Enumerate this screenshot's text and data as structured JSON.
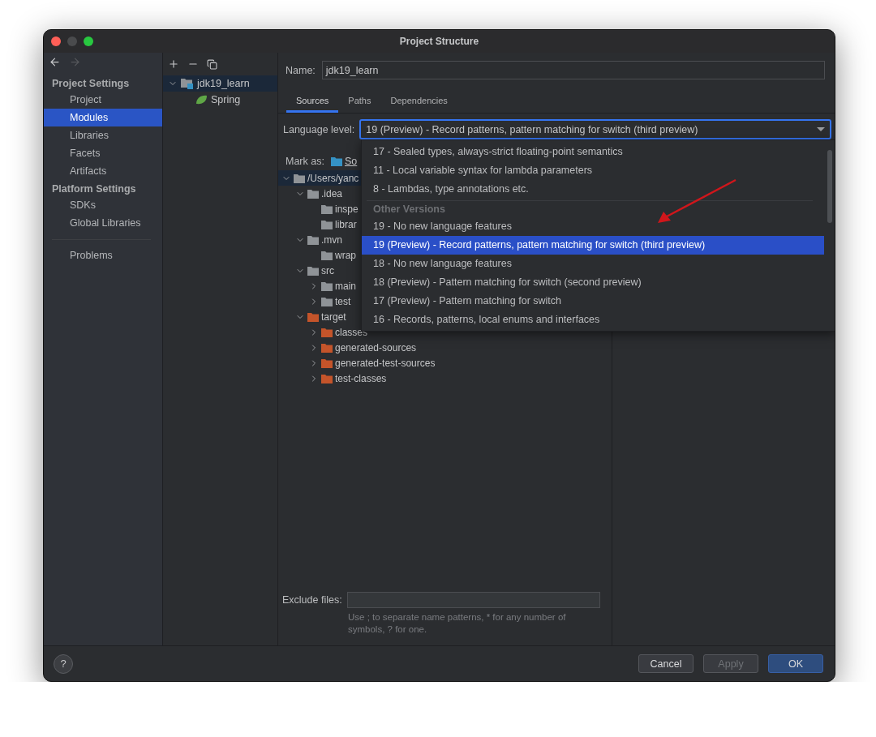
{
  "window": {
    "title": "Project Structure"
  },
  "sidebar": {
    "sections": [
      {
        "title": "Project Settings",
        "items": [
          {
            "label": "Project",
            "selected": false
          },
          {
            "label": "Modules",
            "selected": true
          },
          {
            "label": "Libraries",
            "selected": false
          },
          {
            "label": "Facets",
            "selected": false
          },
          {
            "label": "Artifacts",
            "selected": false
          }
        ]
      },
      {
        "title": "Platform Settings",
        "items": [
          {
            "label": "SDKs",
            "selected": false
          },
          {
            "label": "Global Libraries",
            "selected": false
          }
        ]
      }
    ],
    "extra_items": [
      {
        "label": "Problems",
        "selected": false
      }
    ]
  },
  "modules": [
    {
      "label": "jdk19_learn",
      "kind": "module",
      "expanded": true,
      "selected": true,
      "children": [
        {
          "label": "Spring",
          "kind": "facet",
          "selected": false
        }
      ]
    }
  ],
  "name_field": {
    "label": "Name:",
    "value": "jdk19_learn"
  },
  "tabs": [
    {
      "label": "Sources",
      "selected": true
    },
    {
      "label": "Paths",
      "selected": false
    },
    {
      "label": "Dependencies",
      "selected": false
    }
  ],
  "language_level": {
    "label": "Language level:",
    "value": "19 (Preview) - Record patterns, pattern matching for switch (third preview)",
    "expanded": true,
    "options": [
      {
        "label": "17 - Sealed types, always-strict floating-point semantics",
        "kind": "option",
        "selected": false
      },
      {
        "label": "11 - Local variable syntax for lambda parameters",
        "kind": "option",
        "selected": false
      },
      {
        "label": "8 - Lambdas, type annotations etc.",
        "kind": "option",
        "selected": false
      },
      {
        "label": "Other Versions",
        "kind": "header"
      },
      {
        "label": "19 - No new language features",
        "kind": "option",
        "selected": false
      },
      {
        "label": "19 (Preview) - Record patterns, pattern matching for switch (third preview)",
        "kind": "option",
        "selected": true
      },
      {
        "label": "18 - No new language features",
        "kind": "option",
        "selected": false
      },
      {
        "label": "18 (Preview) - Pattern matching for switch (second preview)",
        "kind": "option",
        "selected": false
      },
      {
        "label": "17 (Preview) - Pattern matching for switch",
        "kind": "option",
        "selected": false
      },
      {
        "label": "16 - Records, patterns, local enums and interfaces",
        "kind": "option",
        "selected": false
      }
    ]
  },
  "mark_as": {
    "label": "Mark as:",
    "items": [
      {
        "label": "So"
      }
    ]
  },
  "content_tree": [
    {
      "label": "/Users/yanc",
      "kind": "folder",
      "expanded": true,
      "selected": true,
      "children": [
        {
          "label": ".idea",
          "kind": "folder",
          "expanded": true,
          "selected": false,
          "children": [
            {
              "label": "inspe",
              "kind": "folder",
              "selected": false
            },
            {
              "label": "librar",
              "kind": "folder",
              "selected": false
            }
          ]
        },
        {
          "label": ".mvn",
          "kind": "folder",
          "expanded": true,
          "selected": false,
          "children": [
            {
              "label": "wrap",
              "kind": "folder",
              "selected": false
            }
          ]
        },
        {
          "label": "src",
          "kind": "folder",
          "expanded": true,
          "selected": false,
          "children": [
            {
              "label": "main",
              "kind": "folder",
              "expanded": false,
              "selected": false
            },
            {
              "label": "test",
              "kind": "folder",
              "expanded": false,
              "selected": false
            }
          ]
        },
        {
          "label": "target",
          "kind": "excluded",
          "expanded": true,
          "selected": false,
          "children": [
            {
              "label": "classes",
              "kind": "excluded",
              "expanded": false,
              "selected": false
            },
            {
              "label": "generated-sources",
              "kind": "excluded",
              "expanded": false,
              "selected": false
            },
            {
              "label": "generated-test-sources",
              "kind": "excluded",
              "expanded": false,
              "selected": false
            },
            {
              "label": "test-classes",
              "kind": "excluded",
              "expanded": false,
              "selected": false
            }
          ]
        }
      ]
    }
  ],
  "exclude_files": {
    "label": "Exclude files:",
    "hint": "Use ; to separate name patterns, * for any number of symbols, ? for one."
  },
  "help": {
    "label": "?"
  },
  "buttons": [
    {
      "label": "Cancel",
      "kind": "normal",
      "disabled": false
    },
    {
      "label": "Apply",
      "kind": "normal",
      "disabled": true
    },
    {
      "label": "OK",
      "kind": "default",
      "disabled": false
    }
  ]
}
